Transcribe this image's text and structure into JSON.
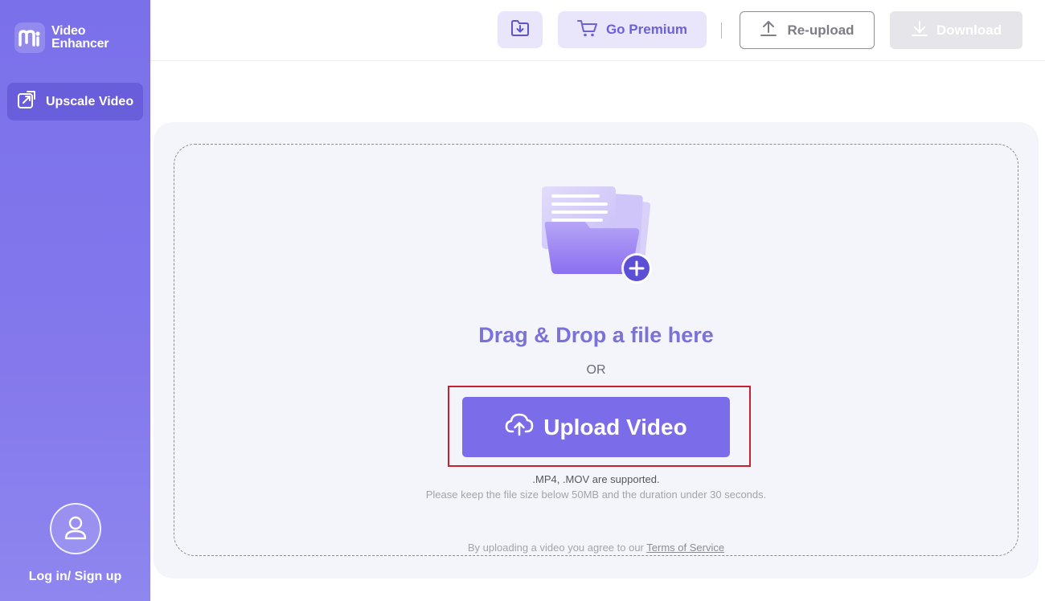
{
  "sidebar": {
    "logo": {
      "line1": "Video",
      "line2": "Enhancer",
      "icon": "m-logo-icon"
    },
    "nav": [
      {
        "label": "Upscale Video",
        "icon": "upscale-icon",
        "active": true
      }
    ],
    "user": {
      "label": "Log in/ Sign up",
      "icon": "user-icon"
    }
  },
  "header": {
    "icon_button": {
      "icon": "folder-download-icon"
    },
    "premium": {
      "label": "Go Premium",
      "icon": "cart-icon"
    },
    "reupload": {
      "label": "Re-upload",
      "icon": "upload-arrow-icon"
    },
    "download": {
      "label": "Download",
      "icon": "download-arrow-icon",
      "disabled": true
    }
  },
  "upload": {
    "illustration_icon": "folder-add-icon",
    "title": "Drag & Drop a file here",
    "or": "OR",
    "button_label": "Upload Video",
    "button_icon": "cloud-upload-icon",
    "formats": ".MP4, .MOV are supported.",
    "limits": "Please keep the file size below 50MB and the duration under 30 seconds.",
    "terms_prefix": "By uploading a video you agree to our",
    "terms_link": "Terms of Service"
  },
  "colors": {
    "sidebar": "#7a70ea",
    "accent": "#7b6ce9",
    "highlight": "#c8202e"
  }
}
